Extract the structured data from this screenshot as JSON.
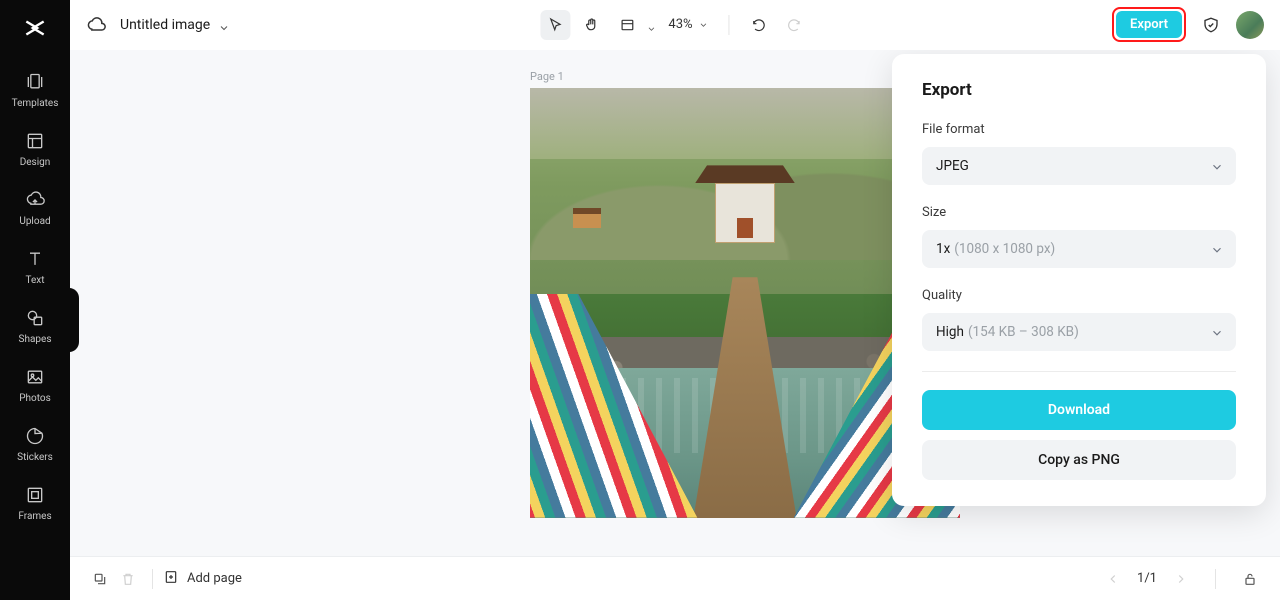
{
  "sidebar": {
    "items": [
      {
        "label": "Templates"
      },
      {
        "label": "Design"
      },
      {
        "label": "Upload"
      },
      {
        "label": "Text"
      },
      {
        "label": "Shapes"
      },
      {
        "label": "Photos"
      },
      {
        "label": "Stickers"
      },
      {
        "label": "Frames"
      }
    ]
  },
  "header": {
    "title": "Untitled image",
    "zoom": "43%",
    "export_label": "Export"
  },
  "canvas": {
    "page_label": "Page 1"
  },
  "export_panel": {
    "title": "Export",
    "format_label": "File format",
    "format_value": "JPEG",
    "size_label": "Size",
    "size_value": "1x",
    "size_hint": "(1080 x 1080 px)",
    "quality_label": "Quality",
    "quality_value": "High",
    "quality_hint": "(154 KB – 308 KB)",
    "download_label": "Download",
    "copy_label": "Copy as PNG"
  },
  "bottombar": {
    "add_page": "Add page",
    "page_indicator": "1/1"
  }
}
